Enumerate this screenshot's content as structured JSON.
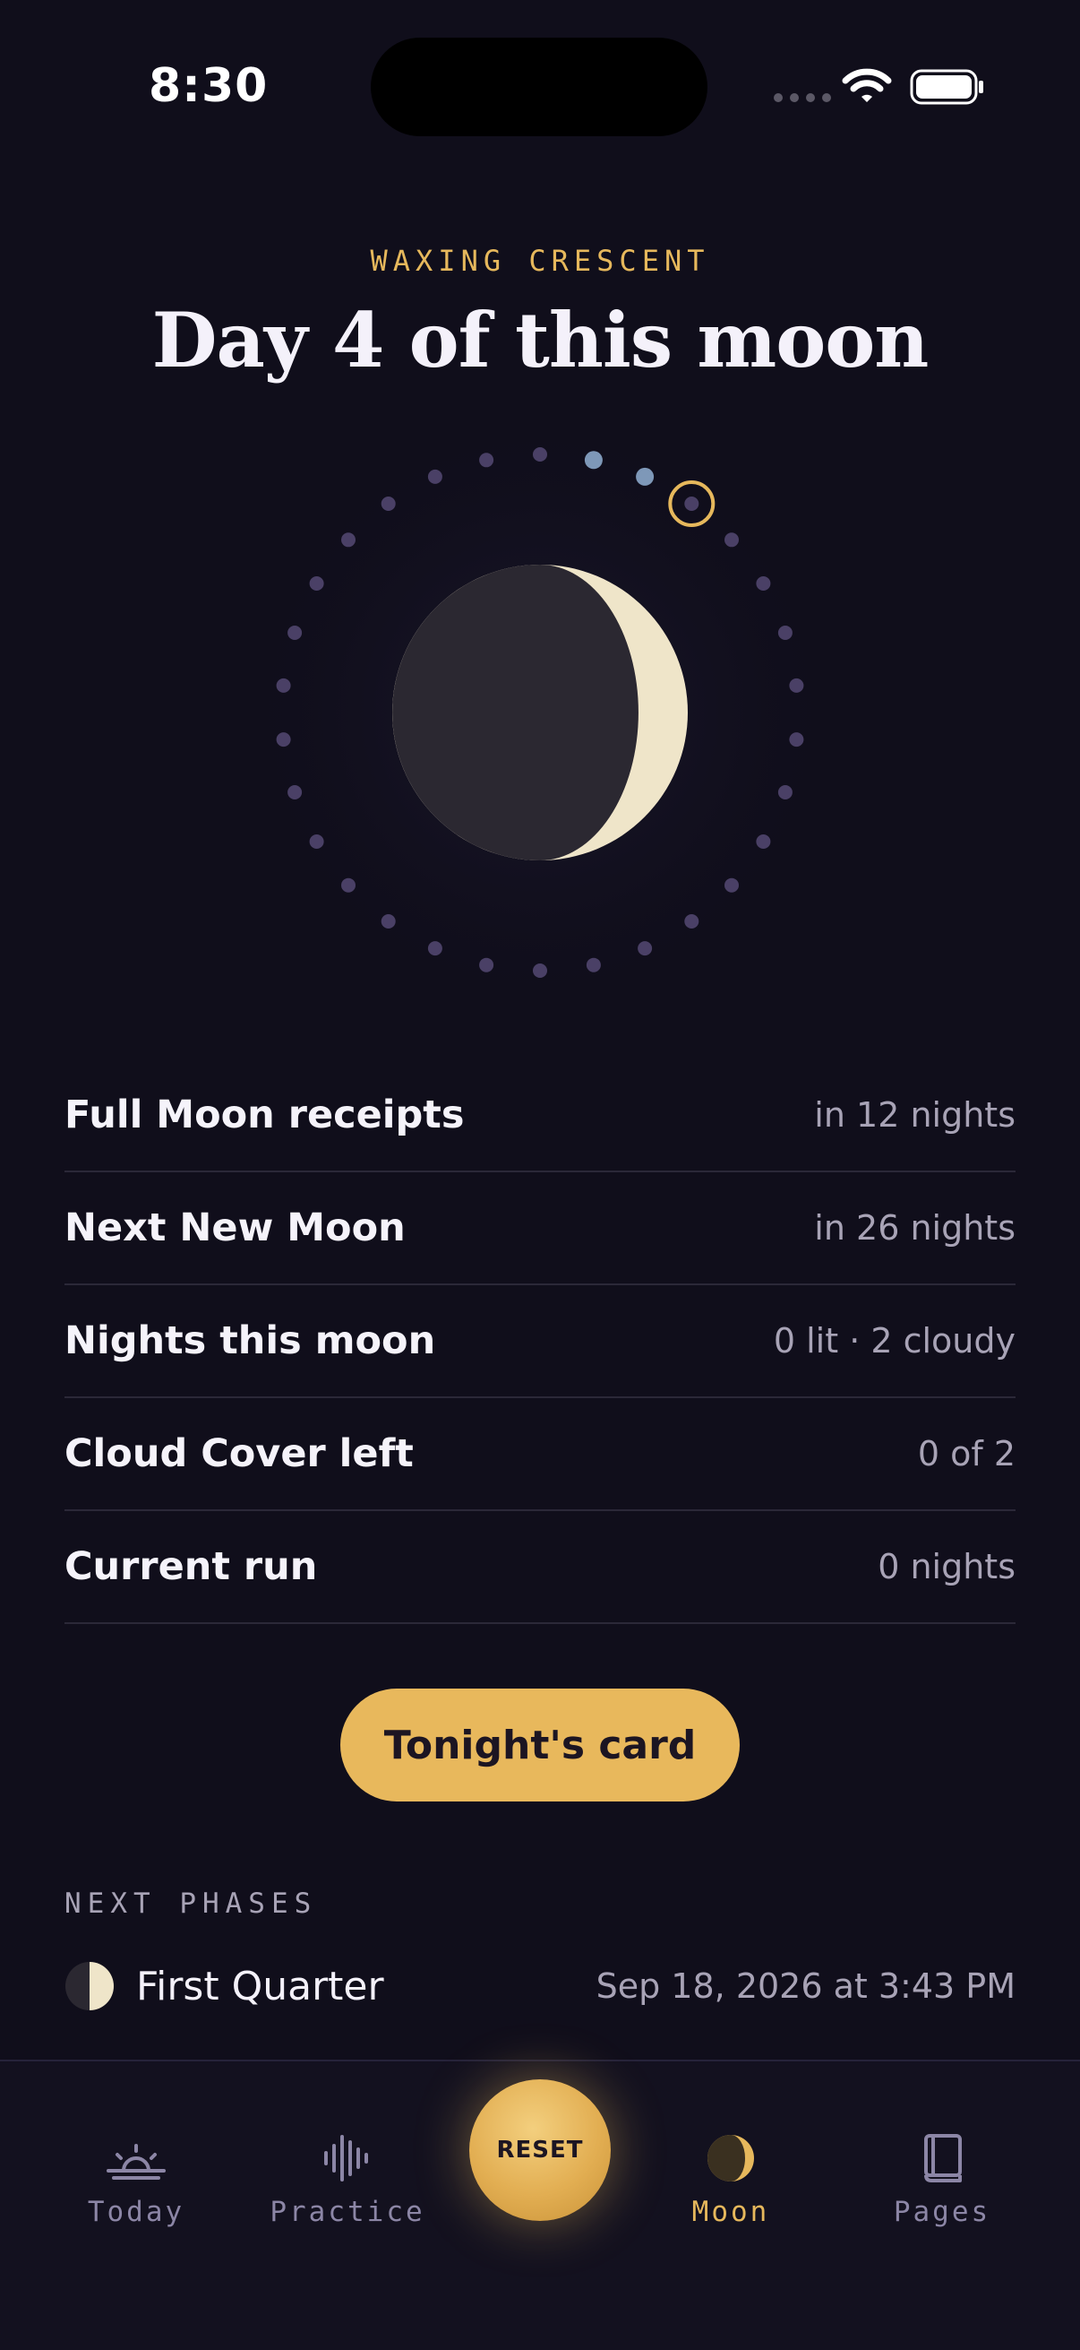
{
  "status_bar": {
    "time": "8:30"
  },
  "header": {
    "phase_label": "WAXING CRESCENT",
    "title": "Day 4 of this moon"
  },
  "moon_dial": {
    "total_nights": 30,
    "current_night": 4,
    "cloudy_nights": [
      1,
      2
    ],
    "colors": {
      "dot": "#4a4066",
      "cloudy_dot": "#7e98b8",
      "current_ring": "#e6b85c",
      "moon_lit": "#efe5c9",
      "moon_dark": "#2b2831"
    }
  },
  "info_rows": [
    {
      "label": "Full Moon receipts",
      "value": "in 12 nights"
    },
    {
      "label": "Next New Moon",
      "value": "in 26 nights"
    },
    {
      "label": "Nights this moon",
      "value": "0 lit · 2 cloudy"
    },
    {
      "label": "Cloud Cover left",
      "value": "0 of 2"
    },
    {
      "label": "Current run",
      "value": "0 nights"
    }
  ],
  "tonight_button": {
    "label": "Tonight's card"
  },
  "next_phases": {
    "heading": "NEXT PHASES",
    "items": [
      {
        "name": "First Quarter",
        "date": "Sep 18, 2026 at 3:43 PM",
        "icon": "first-quarter-icon"
      }
    ]
  },
  "tab_bar": {
    "tabs": [
      {
        "label": "Today",
        "icon": "sunrise-icon",
        "active": false
      },
      {
        "label": "Practice",
        "icon": "soundwave-icon",
        "active": false
      },
      {
        "label": "Moon",
        "icon": "crescent-moon-icon",
        "active": true
      },
      {
        "label": "Pages",
        "icon": "book-icon",
        "active": false
      }
    ],
    "center_button": "RESET"
  },
  "accent_color": "#e6b85c",
  "background_color": "#100e1b"
}
